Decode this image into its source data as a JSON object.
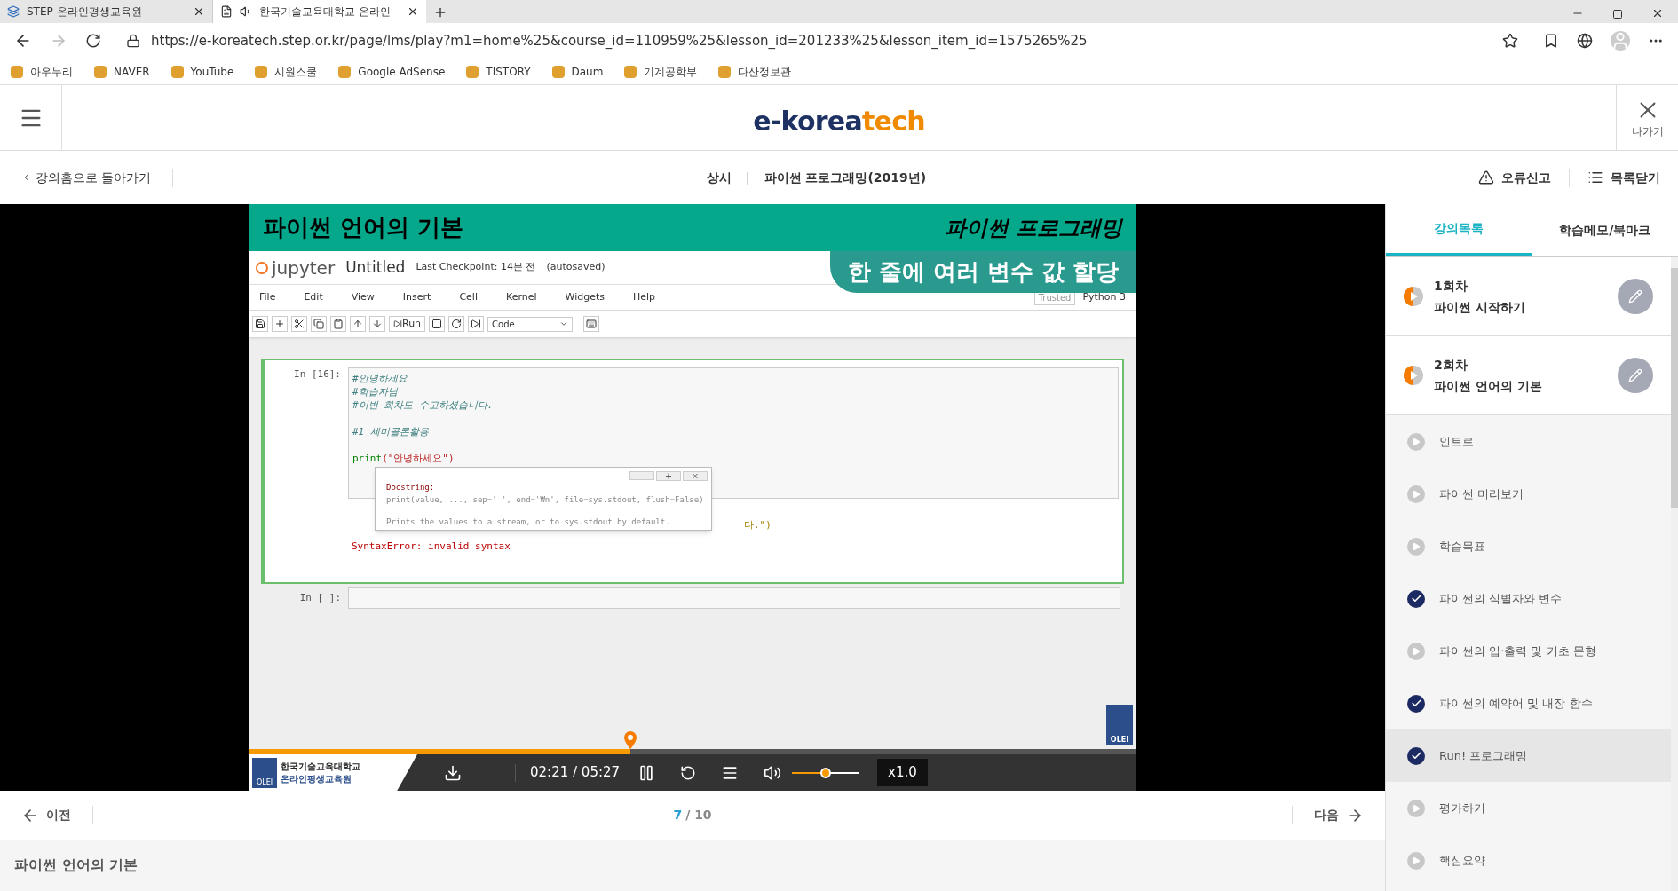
{
  "browser": {
    "tabs": [
      {
        "title": "STEP 온라인평생교육원",
        "selected": false
      },
      {
        "title": "한국기술교육대학교 온라인",
        "selected": true
      }
    ],
    "url": "https://e-koreatech.step.or.kr/page/lms/play?m1=home%25&course_id=110959%25&lesson_id=201233%25&lesson_item_id=1575265%25",
    "bookmarks": [
      "아우누리",
      "NAVER",
      "YouTube",
      "시원스쿨",
      "Google AdSense",
      "TISTORY",
      "Daum",
      "기계공학부",
      "다산정보관"
    ]
  },
  "header": {
    "logo_main": "e-korea",
    "logo_accent": "tech",
    "exit_label": "나가기"
  },
  "subnav": {
    "back": "강의홈으로 돌아가기",
    "tag": "상시",
    "separator": "|",
    "course": "파이썬 프로그래밍(2019년)",
    "report": "오류신고",
    "close_list": "목록닫기"
  },
  "video": {
    "banner_title": "파이썬 언어의 기본",
    "brand": "파이썬 프로그래밍",
    "subtitle": "한 줄에 여러 변수 값 할당",
    "jupyter": {
      "logo": "jupyter",
      "title": "Untitled",
      "checkpoint": "Last Checkpoint: 14분 전",
      "autosaved": "(autosaved)",
      "menu": [
        "File",
        "Edit",
        "View",
        "Insert",
        "Cell",
        "Kernel",
        "Widgets",
        "Help"
      ],
      "trusted": "Trusted",
      "kernel": "Python 3",
      "run": "Run",
      "cell_type": "Code",
      "cell": {
        "prompt": "In [16]:",
        "lines": [
          {
            "kind": "comment",
            "text": "#안녕하세요"
          },
          {
            "kind": "comment",
            "text": "#학습자님"
          },
          {
            "kind": "comment",
            "text": "#이번 회차도 수고하셨습니다."
          },
          {
            "kind": "blank"
          },
          {
            "kind": "comment",
            "text": "#1 세미콜론활용"
          },
          {
            "kind": "blank"
          },
          {
            "kind": "call",
            "text": "print",
            "arg": "(\"안녕하세요\")"
          }
        ],
        "output_tail": "다.\")",
        "error": "SyntaxError: invalid syntax"
      },
      "tooltip": {
        "heading": "Docstring:",
        "signature": "print(value, ..., sep=' ', end='₩n', file=sys.stdout, flush=False)",
        "description": "Prints the values to a stream, or to sys.stdout by default."
      },
      "empty_prompt": "In [ ]:"
    },
    "watermark": "OLEI"
  },
  "player": {
    "level": 0.43,
    "current": "02:21",
    "time_separator": "/",
    "total": "05:27",
    "volume": {
      "level": 0.5
    },
    "speed": "x1.0",
    "institute": [
      "한국기술교육대학교",
      "온라인평생교육원"
    ],
    "logo_label": "OLEI"
  },
  "pager": {
    "prev": "이전",
    "current": "7",
    "separator": "/",
    "total": "10",
    "next": "다음"
  },
  "lesson_title": "파이썬 언어의 기본",
  "sidebar": {
    "tabs": [
      {
        "label": "강의목록",
        "selected": true
      },
      {
        "label": "학습메모/북마크",
        "selected": false
      }
    ],
    "sessions": [
      {
        "number": "1회차",
        "title": "파이썬 시작하기"
      },
      {
        "number": "2회차",
        "title": "파이썬 언어의 기본"
      }
    ],
    "items": [
      {
        "label": "인트로",
        "completed": false,
        "selected": false
      },
      {
        "label": "파이썬 미리보기",
        "completed": false,
        "selected": false
      },
      {
        "label": "학습목표",
        "completed": false,
        "selected": false
      },
      {
        "label": "파이썬의 식별자와 변수",
        "completed": true,
        "selected": false
      },
      {
        "label": "파이썬의 입·출력 및 기초 문형",
        "completed": false,
        "selected": false
      },
      {
        "label": "파이썬의 예약어 및 내장 함수",
        "completed": true,
        "selected": false
      },
      {
        "label": "Run! 프로그래밍",
        "completed": true,
        "selected": true
      },
      {
        "label": "평가하기",
        "completed": false,
        "selected": false
      },
      {
        "label": "핵심요약",
        "completed": false,
        "selected": false
      }
    ]
  }
}
